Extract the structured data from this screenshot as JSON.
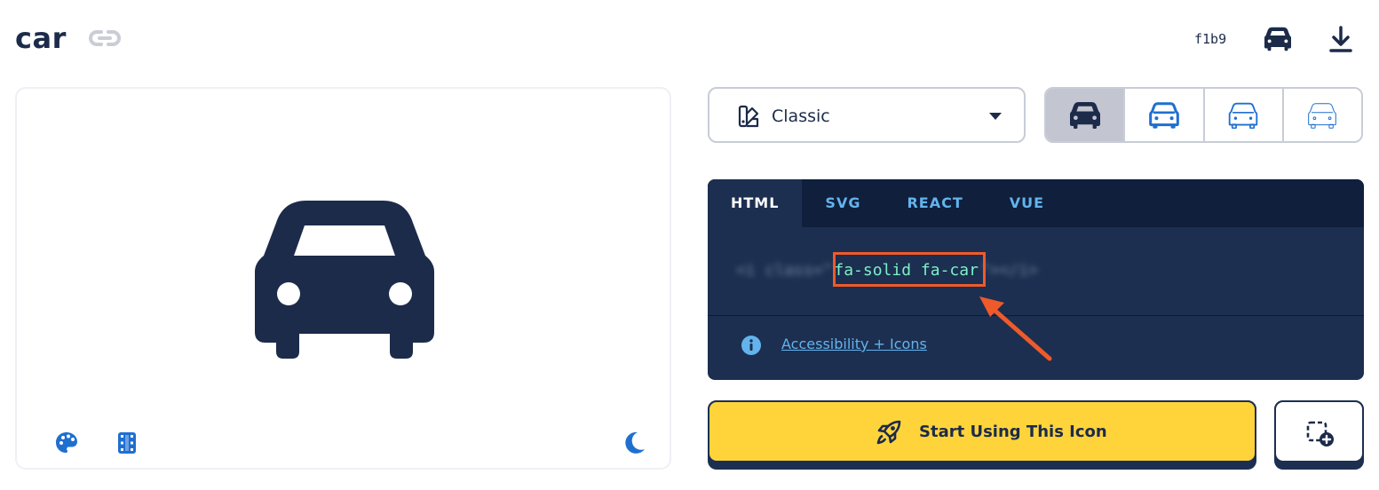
{
  "header": {
    "title": "car",
    "unicode": "f1b9"
  },
  "preview": {
    "icon": "car-icon"
  },
  "style_select": {
    "label": "Classic"
  },
  "variants": [
    "solid",
    "regular",
    "light",
    "thin"
  ],
  "code": {
    "tabs": [
      "HTML",
      "SVG",
      "REACT",
      "VUE"
    ],
    "active_tab": "HTML",
    "prefix": "<i class=\"",
    "class_name": "fa-solid fa-car",
    "suffix": "\"></i>",
    "accessibility_link": "Accessibility + Icons"
  },
  "actions": {
    "start_label": "Start Using This Icon"
  },
  "colors": {
    "navy": "#1c2b4a",
    "accent_blue": "#1f6fd1",
    "code_bg": "#1c2f50",
    "tab_bar_bg": "#0f1f3c",
    "yellow": "#ffd43b",
    "highlight": "#ef5a2a"
  }
}
